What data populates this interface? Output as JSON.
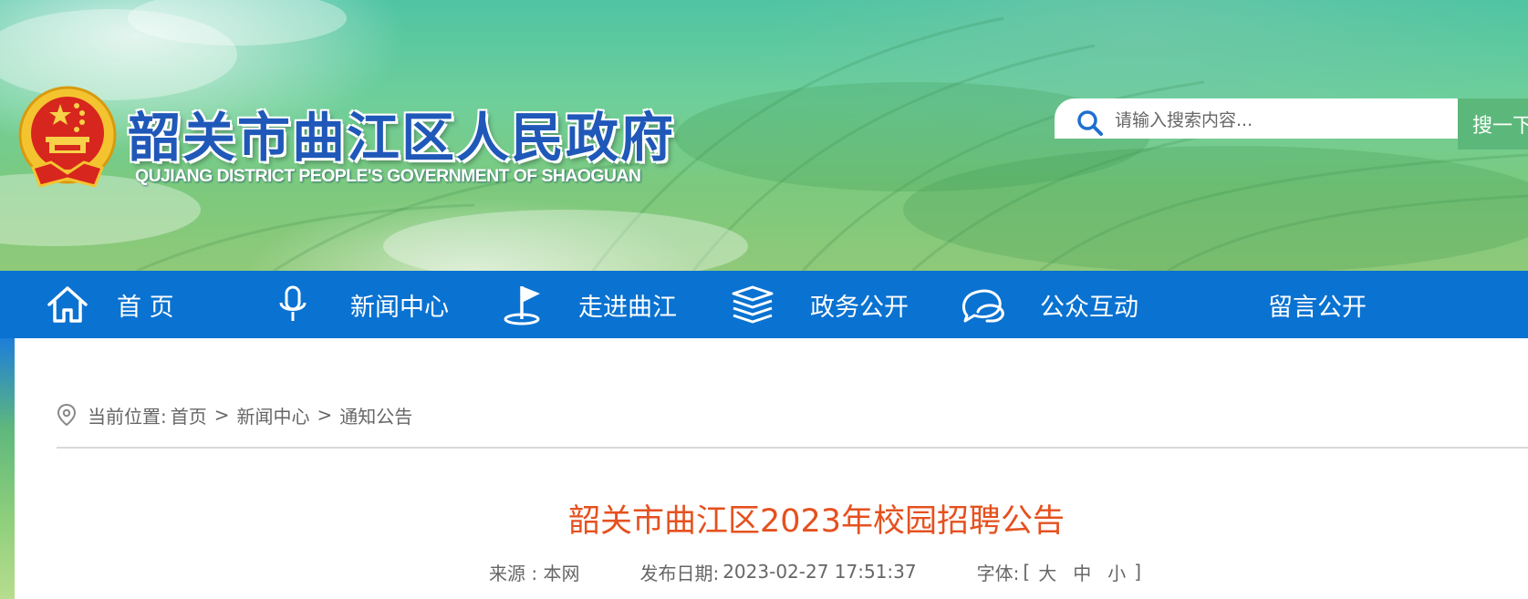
{
  "header": {
    "site_title": "韶关市曲江区人民政府",
    "site_subtitle": "QUJIANG DISTRICT PEOPLE'S GOVERNMENT OF SHAOGUAN",
    "search": {
      "placeholder": "请输入搜索内容...",
      "button_label": "搜一下"
    }
  },
  "nav": {
    "items": [
      {
        "label": "首 页",
        "icon": "home-icon"
      },
      {
        "label": "新闻中心",
        "icon": "microphone-icon"
      },
      {
        "label": "走进曲江",
        "icon": "flag-icon"
      },
      {
        "label": "政务公开",
        "icon": "layers-icon"
      },
      {
        "label": "公众互动",
        "icon": "chat-bubbles-icon"
      },
      {
        "label": "留言公开",
        "icon": ""
      }
    ]
  },
  "breadcrumb": {
    "prefix": "当前位置:",
    "items": [
      "首页",
      "新闻中心",
      "通知公告"
    ],
    "separator": ">"
  },
  "article": {
    "title": "韶关市曲江区2023年校园招聘公告",
    "source_label": "来源 : 本网",
    "date_label": "发布日期:",
    "date": "2023-02-27 17:51:37",
    "font_label": "字体:",
    "bracket_open": "[",
    "bracket_close": "]",
    "font_sizes": [
      "大",
      "中",
      "小"
    ]
  },
  "colors": {
    "nav_bg": "#0a72d1",
    "title_blue": "#1f58b8",
    "article_title": "#e5511f",
    "search_button": "#5cb87a"
  }
}
